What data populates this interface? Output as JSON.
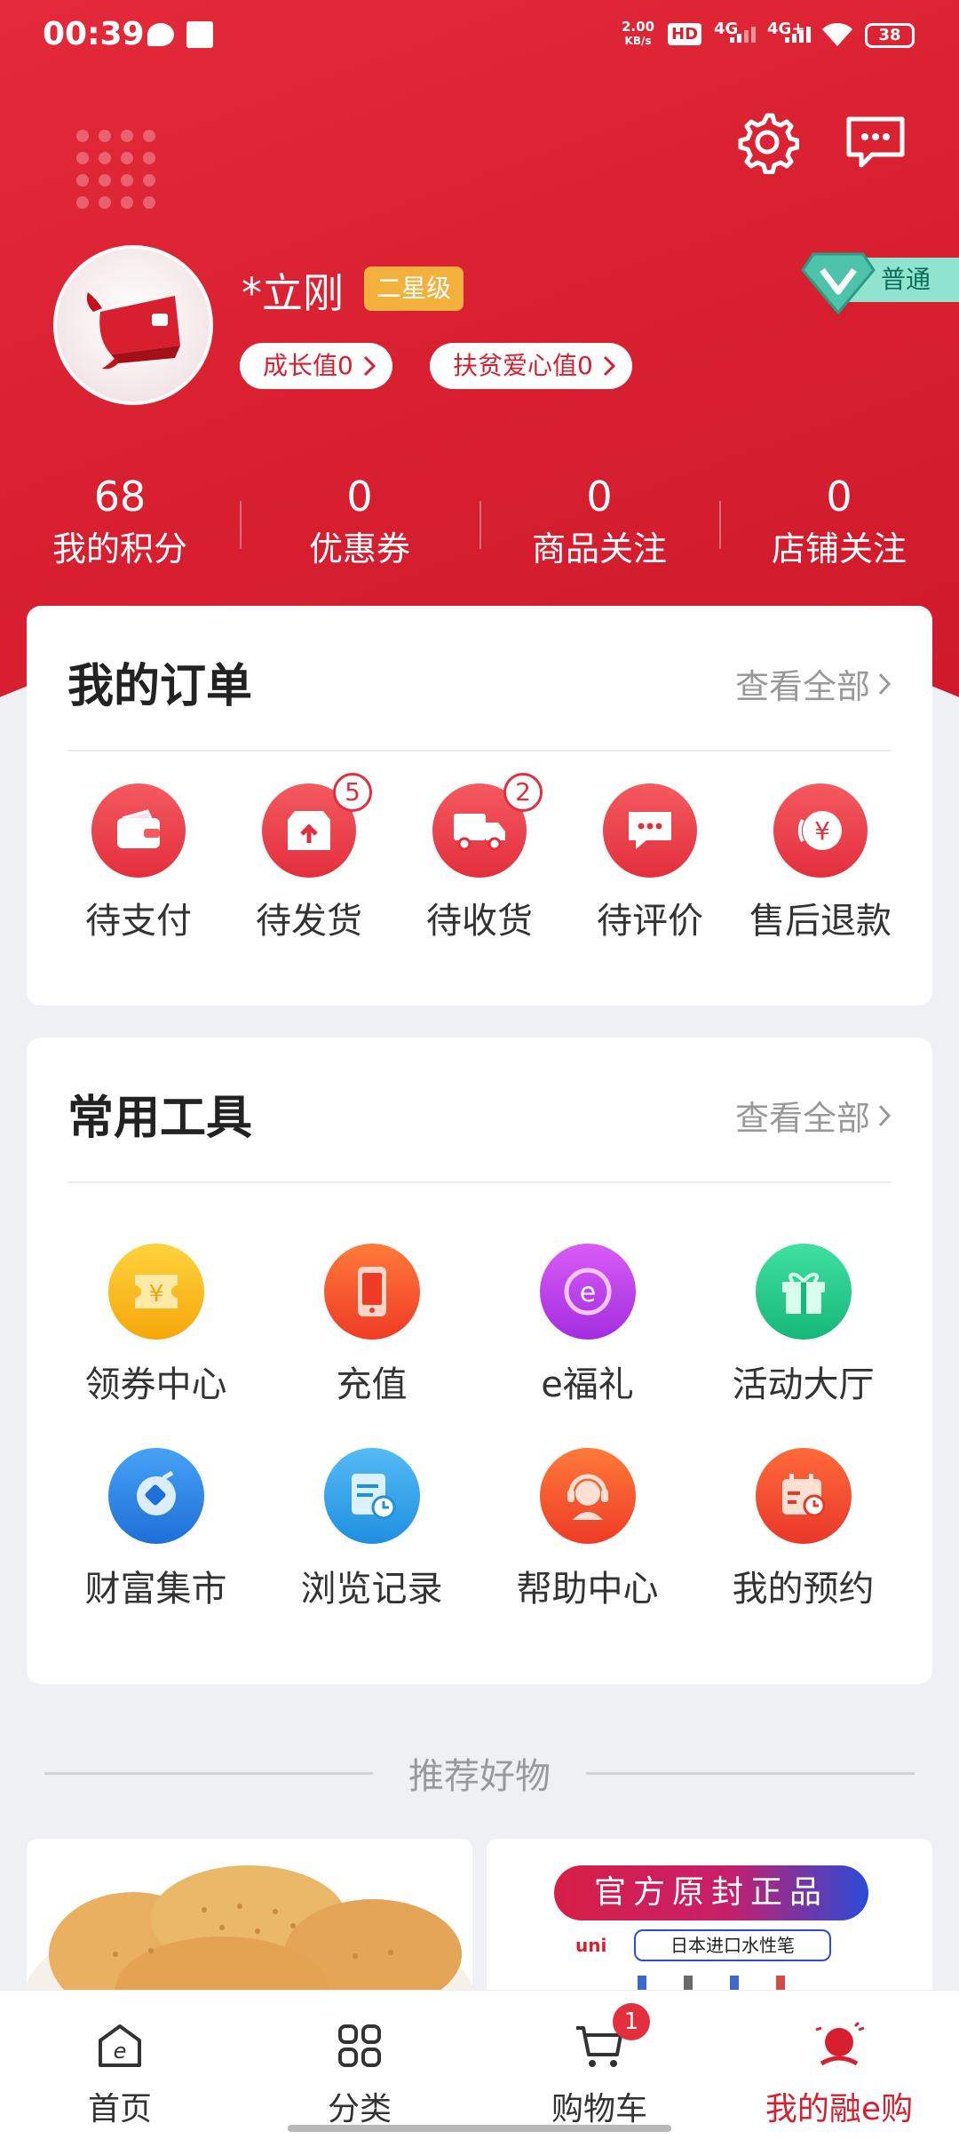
{
  "status_bar": {
    "time": "00:39",
    "net_speed_value": "2.00",
    "net_speed_unit": "KB/s",
    "hd": "HD",
    "signal1": "4G",
    "signal2": "4G+",
    "battery": "38"
  },
  "profile": {
    "username": "*立刚",
    "level": "二星级",
    "growth": "成长值0",
    "charity": "扶贫爱心值0",
    "vip": "普通"
  },
  "stats": [
    {
      "value": "68",
      "label": "我的积分"
    },
    {
      "value": "0",
      "label": "优惠券"
    },
    {
      "value": "0",
      "label": "商品关注"
    },
    {
      "value": "0",
      "label": "店铺关注"
    }
  ],
  "orders": {
    "title": "我的订单",
    "more": "查看全部",
    "items": [
      {
        "label": "待支付",
        "icon": "wallet-icon",
        "badge": ""
      },
      {
        "label": "待发货",
        "icon": "box-icon",
        "badge": "5"
      },
      {
        "label": "待收货",
        "icon": "truck-icon",
        "badge": "2"
      },
      {
        "label": "待评价",
        "icon": "comment-icon",
        "badge": ""
      },
      {
        "label": "售后退款",
        "icon": "refund-icon",
        "badge": ""
      }
    ]
  },
  "tools": {
    "title": "常用工具",
    "more": "查看全部",
    "items": [
      {
        "label": "领券中心",
        "icon": "coupon-icon",
        "color": "#f5b50a"
      },
      {
        "label": "充值",
        "icon": "phone-icon",
        "color": "#f24a2a"
      },
      {
        "label": "e福礼",
        "icon": "e-gift-icon",
        "color": "#b43ee6"
      },
      {
        "label": "活动大厅",
        "icon": "gift-icon",
        "color": "#27c98a"
      },
      {
        "label": "财富集市",
        "icon": "wealth-icon",
        "color": "#2f86e6"
      },
      {
        "label": "浏览记录",
        "icon": "history-icon",
        "color": "#2fa3ea"
      },
      {
        "label": "帮助中心",
        "icon": "support-icon",
        "color": "#f24a2a"
      },
      {
        "label": "我的预约",
        "icon": "calendar-icon",
        "color": "#f2452a"
      }
    ]
  },
  "recommend": {
    "title": "推荐好物",
    "product2_banner": "官方原封正品",
    "product2_brand": "uni",
    "product2_sub": "日本进口水性笔"
  },
  "tabbar": {
    "items": [
      {
        "label": "首页",
        "icon": "home-icon"
      },
      {
        "label": "分类",
        "icon": "category-icon"
      },
      {
        "label": "购物车",
        "icon": "cart-icon"
      },
      {
        "label": "我的融e购",
        "icon": "profile-icon"
      }
    ],
    "cart_badge": "1",
    "active_color": "#d71f30"
  },
  "colors": {
    "brand_red": "#d71f30",
    "level_gold": "#f2b13c",
    "vip_teal": "#8fe3cf"
  }
}
